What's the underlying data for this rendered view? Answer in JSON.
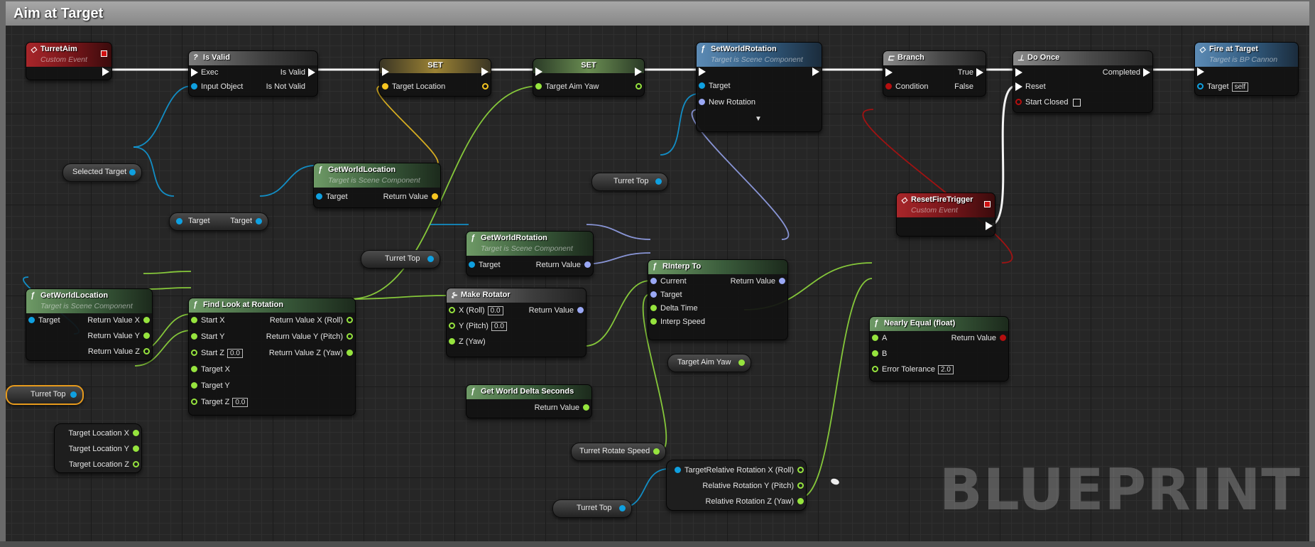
{
  "graph": {
    "title": "Aim at Target",
    "watermark": "BLUEPRINT"
  },
  "colors": {
    "exec": "#ffffff",
    "object": "#0fa0e0",
    "vector": "#f6c521",
    "float": "#96e43e",
    "rotator": "#9aa8f5",
    "bool": "#b50f0f"
  },
  "nodes": {
    "turret_aim": {
      "title": "TurretAim",
      "subtitle": "Custom Event"
    },
    "is_valid": {
      "icon": "?",
      "title": "Is Valid",
      "exec": "Exec",
      "input_object": "Input Object",
      "is_valid": "Is Valid",
      "is_not_valid": "Is Not Valid"
    },
    "set_location": {
      "title": "SET",
      "target_location": "Target Location"
    },
    "set_yaw": {
      "title": "SET",
      "target_aim_yaw": "Target Aim Yaw"
    },
    "set_world_rotation": {
      "title": "SetWorldRotation",
      "subtitle": "Target is Scene Component",
      "target": "Target",
      "new_rotation": "New Rotation",
      "expand": "▼"
    },
    "branch": {
      "title": "Branch",
      "condition": "Condition",
      "true_label": "True",
      "false_label": "False"
    },
    "do_once": {
      "title": "Do Once",
      "completed": "Completed",
      "reset": "Reset",
      "start_closed": "Start Closed"
    },
    "fire_at_target": {
      "title": "Fire at Target",
      "subtitle": "Target is BP Cannon",
      "target": "Target",
      "self_value": "self"
    },
    "reset_fire_trigger": {
      "title": "ResetFireTrigger",
      "subtitle": "Custom Event"
    },
    "get_world_location_1": {
      "title": "GetWorldLocation",
      "subtitle": "Target is Scene Component",
      "target": "Target",
      "return_value": "Return Value"
    },
    "get_world_rotation": {
      "title": "GetWorldRotation",
      "subtitle": "Target is Scene Component",
      "target": "Target",
      "return_value": "Return Value"
    },
    "rinterp_to": {
      "title": "RInterp To",
      "current": "Current",
      "target": "Target",
      "delta_time": "Delta Time",
      "interp_speed": "Interp Speed",
      "return_value": "Return Value"
    },
    "make_rotator": {
      "title": "Make Rotator",
      "x_roll": "X (Roll)",
      "x_value": "0.0",
      "y_pitch": "Y (Pitch)",
      "y_value": "0.0",
      "z_yaw": "Z (Yaw)",
      "return_value": "Return Value"
    },
    "get_world_location_2": {
      "title": "GetWorldLocation",
      "subtitle": "Target is Scene Component",
      "target": "Target",
      "return_x": "Return Value X",
      "return_y": "Return Value Y",
      "return_z": "Return Value Z"
    },
    "find_look_at": {
      "title": "Find Look at Rotation",
      "start_x": "Start X",
      "start_y": "Start Y",
      "start_z": "Start Z",
      "start_z_value": "0.0",
      "target_x": "Target X",
      "target_y": "Target Y",
      "target_z": "Target Z",
      "target_z_value": "0.0",
      "ret_roll": "Return Value X (Roll)",
      "ret_pitch": "Return Value Y (Pitch)",
      "ret_yaw": "Return Value Z (Yaw)"
    },
    "get_world_delta": {
      "title": "Get World Delta Seconds",
      "return_value": "Return Value"
    },
    "nearly_equal": {
      "title": "Nearly Equal (float)",
      "a": "A",
      "b": "B",
      "error_tolerance": "Error Tolerance",
      "error_value": "2.0",
      "return_value": "Return Value"
    },
    "break_rotation": {
      "target": "Target",
      "rel_x": "Relative Rotation X (Roll)",
      "rel_y": "Relative Rotation Y (Pitch)",
      "rel_z": "Relative Rotation Z (Yaw)"
    },
    "target_loc_break": {
      "x": "Target Location X",
      "y": "Target Location Y",
      "z": "Target Location Z"
    },
    "target_getter": {
      "left": "Target",
      "right": "Target"
    }
  },
  "variables": {
    "selected_target": "Selected Target",
    "turret_top": "Turret Top",
    "target_aim_yaw": "Target Aim Yaw",
    "turret_rotate_speed": "Turret Rotate Speed"
  }
}
